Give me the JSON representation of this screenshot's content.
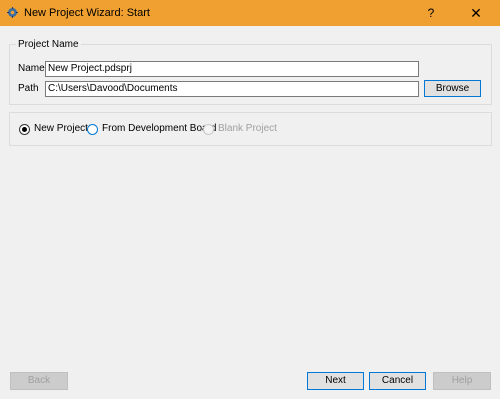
{
  "window": {
    "title": "New Project Wizard: Start",
    "help_glyph": "?",
    "close_glyph": "✕",
    "icons": {
      "app": "gear-app-icon",
      "help": "help-icon",
      "close": "close-icon"
    },
    "titlebar_color": "#f0a030"
  },
  "project_name_group": {
    "title": "Project Name",
    "name_label": "Name",
    "name_value": "New Project.pdsprj",
    "path_label": "Path",
    "path_value": "C:\\Users\\Davood\\Documents",
    "browse_label": "Browse"
  },
  "project_type": {
    "options": [
      {
        "label": "New Project",
        "checked": true,
        "enabled": true
      },
      {
        "label": "From Development Board",
        "checked": false,
        "enabled": true
      },
      {
        "label": "Blank Project",
        "checked": false,
        "enabled": false
      }
    ]
  },
  "footer": {
    "back_label": "Back",
    "next_label": "Next",
    "cancel_label": "Cancel",
    "help_label": "Help"
  },
  "accent_color": "#0078d7"
}
